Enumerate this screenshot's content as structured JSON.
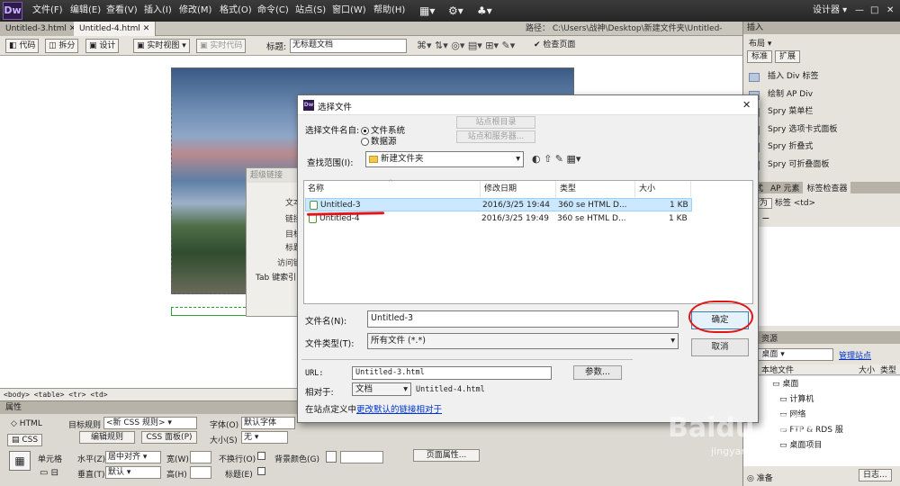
{
  "app": {
    "logo": "Dw",
    "menu": [
      "文件(F)",
      "编辑(E)",
      "查看(V)",
      "插入(I)",
      "修改(M)",
      "格式(O)",
      "命令(C)",
      "站点(S)",
      "窗口(W)",
      "帮助(H)"
    ],
    "workspace": "设计器",
    "window_controls": [
      "—",
      "□",
      "✕"
    ]
  },
  "doc_tabs": [
    "Untitled-3.html",
    "Untitled-4.html"
  ],
  "path_label": "路径：",
  "path_value": "C:\\Users\\战神\\Desktop\\新建文件夹\\Untitled-4.html",
  "toolbar": {
    "code": "代码",
    "split": "拆分",
    "design": "设计",
    "live_view": "实时视图",
    "live_code": "实时代码",
    "title_label": "标题:",
    "title_value": "无标题文档",
    "check_page": "检查页面"
  },
  "hyperlink_dialog": {
    "title": "超级链接",
    "labels": [
      "文本:",
      "链接:",
      "目标:",
      "标题:",
      "访问键:",
      "Tab 键索引:"
    ]
  },
  "tag_selector": "<body> <table> <tr> <td>",
  "properties": {
    "header": "属性",
    "html_btn": "HTML",
    "css_btn": "CSS",
    "target_rule_label": "目标规则",
    "target_rule_value": "<新 CSS 规则>",
    "edit_rule": "编辑规则",
    "css_panel": "CSS 面板(P)",
    "font_label": "字体(O)",
    "font_value": "默认字体",
    "size_label": "大小(S)",
    "size_value": "无",
    "cell_label": "单元格",
    "horz_label": "水平(Z)",
    "horz_value": "居中对齐",
    "vert_label": "垂直(T)",
    "vert_value": "默认",
    "width_label": "宽(W)",
    "height_label": "高(H)",
    "nowrap_label": "不换行(O)",
    "header_label": "标题(E)",
    "bgcolor_label": "背景颜色(G)",
    "page_props": "页面属性..."
  },
  "right_panel": {
    "insert_tab": "插入",
    "layout_label": "布局",
    "std_btn": "标准",
    "expand_btn": "扩展",
    "insert_items": [
      "插入 Div 标签",
      "绘制 AP Div",
      "Spry 菜单栏",
      "Spry 选项卡式面板",
      "Spry 折叠式",
      "Spry 可折叠面板"
    ],
    "tabs2": [
      "样式",
      "AP 元素",
      "标签检查器"
    ],
    "behavior_btn": "行为",
    "tag_label": "标签 <td>",
    "files_tab": "资源",
    "site_select": "桌面",
    "manage_site": "管理站点",
    "col_local": "本地文件",
    "col_size": "大小",
    "col_type": "类型",
    "tree": [
      "桌面",
      "计算机",
      "网络",
      "FTP & RDS 服",
      "桌面项目"
    ],
    "status_ready": "准备",
    "log_btn": "日志..."
  },
  "dialog": {
    "icon": "Dw",
    "title": "选择文件",
    "select_from_label": "选择文件名自:",
    "radio_fs": "文件系统",
    "radio_ds": "数据源",
    "site_root_btn": "站点根目录",
    "site_server_btn": "站点和服务器...",
    "look_in_label": "查找范围(I):",
    "look_in_value": "新建文件夹",
    "columns": [
      "名称",
      "修改日期",
      "类型",
      "大小"
    ],
    "files": [
      {
        "name": "Untitled-3",
        "date": "2016/3/25 19:44",
        "type": "360 se HTML D...",
        "size": "1 KB",
        "selected": true
      },
      {
        "name": "Untitled-4",
        "date": "2016/3/25 19:49",
        "type": "360 se HTML D...",
        "size": "1 KB",
        "selected": false
      }
    ],
    "filename_label": "文件名(N):",
    "filename_value": "Untitled-3",
    "filetype_label": "文件类型(T):",
    "filetype_value": "所有文件 (*.*)",
    "ok": "确定",
    "cancel": "取消",
    "url_label": "URL:",
    "url_value": "Untitled-3.html",
    "params_btn": "参数...",
    "relative_label": "相对于:",
    "relative_value": "文档",
    "relative_doc": "Untitled-4.html",
    "site_def_text": "在站点定义中",
    "site_def_link": "更改默认的链接相对于",
    "close": "✕"
  },
  "watermark": {
    "text": "Baidu 经验",
    "url": "jingyan.baidu.com"
  },
  "colors": {
    "accent_red": "#e0161a",
    "selection": "#cce8ff",
    "link": "#0033cc"
  }
}
